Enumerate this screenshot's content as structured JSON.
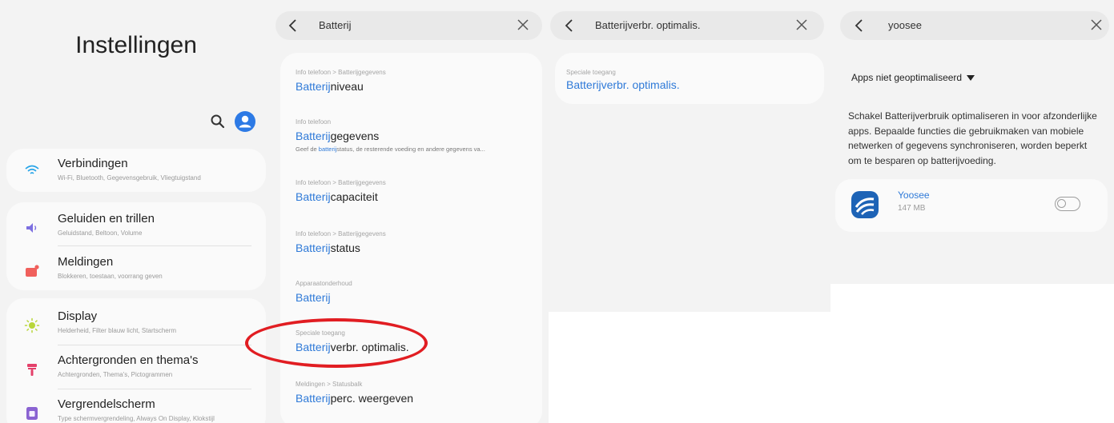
{
  "settings": {
    "title": "Instellingen",
    "items": [
      {
        "title": "Verbindingen",
        "subtitle": "Wi-Fi, Bluetooth, Gegevensgebruik, Vliegtuigstand"
      },
      {
        "title": "Geluiden en trillen",
        "subtitle": "Geluidstand, Beltoon, Volume"
      },
      {
        "title": "Meldingen",
        "subtitle": "Blokkeren, toestaan, voorrang geven"
      },
      {
        "title": "Display",
        "subtitle": "Helderheid, Filter blauw licht, Startscherm"
      },
      {
        "title": "Achtergronden en thema's",
        "subtitle": "Achtergronden, Thema's, Pictogrammen"
      },
      {
        "title": "Vergrendelscherm",
        "subtitle": "Type schermvergrendeling, Always On Display, Klokstijl"
      }
    ]
  },
  "battery_search": {
    "query": "Batterij",
    "results": [
      {
        "category": "Info telefoon > Batterijgegevens",
        "highlight": "Batterij",
        "rest": "niveau"
      },
      {
        "category": "Info telefoon",
        "highlight": "Batterij",
        "rest": "gegevens",
        "desc_pre": "Geef de ",
        "desc_hl": "batterij",
        "desc_post": "status, de resterende voeding en andere gegevens va..."
      },
      {
        "category": "Info telefoon > Batterijgegevens",
        "highlight": "Batterij",
        "rest": "capaciteit"
      },
      {
        "category": "Info telefoon > Batterijgegevens",
        "highlight": "Batterij",
        "rest": "status"
      },
      {
        "category": "Apparaatonderhoud",
        "highlight": "Batterij",
        "rest": ""
      },
      {
        "category": "Speciale toegang",
        "highlight": "Batterij",
        "rest": "verbr. optimalis."
      },
      {
        "category": "Meldingen > Statusbalk",
        "highlight": "Batterij",
        "rest": "perc. weergeven"
      }
    ]
  },
  "optim_search": {
    "query": "Batterijverbr. optimalis.",
    "result": {
      "category": "Speciale toegang",
      "highlight": "Batterijverbr. optimalis."
    }
  },
  "app_search": {
    "query": "yoosee",
    "filter": "Apps niet geoptimaliseerd",
    "info": "Schakel Batterijverbruik optimaliseren in voor afzonderlijke apps. Bepaalde functies die gebruikmaken van mobiele netwerken of gegevens synchroniseren, worden beperkt om te besparen op batterijvoeding.",
    "app": {
      "name": "Yoosee",
      "size": "147 MB",
      "optimized": false
    }
  },
  "colors": {
    "accent": "#2f7ad8",
    "highlight_ring": "#e11d22"
  }
}
